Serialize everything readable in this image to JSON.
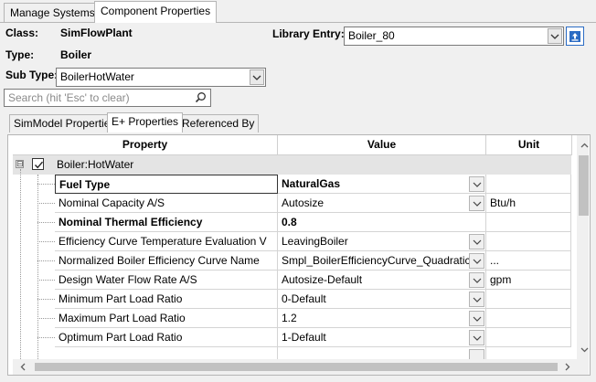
{
  "tabs": [
    {
      "label": "Manage Systems",
      "active": false
    },
    {
      "label": "Component Properties",
      "active": true
    }
  ],
  "header": {
    "class_label": "Class:",
    "class_value": "SimFlowPlant",
    "type_label": "Type:",
    "type_value": "Boiler",
    "subtype_label": "Sub Type:",
    "subtype_value": "BoilerHotWater",
    "library_label": "Library Entry:",
    "library_value": "Boiler_80"
  },
  "search": {
    "placeholder": "Search (hit 'Esc' to clear)"
  },
  "inner_tabs": [
    {
      "label": "SimModel Properties",
      "active": false
    },
    {
      "label": "E+ Properties",
      "active": true
    },
    {
      "label": "Referenced By",
      "active": false
    }
  ],
  "grid": {
    "columns": [
      "Property",
      "Value",
      "Unit"
    ],
    "group": {
      "label": "Boiler:HotWater",
      "checked": true,
      "expander": "⊟"
    },
    "rows": [
      {
        "property": "Fuel Type",
        "value": "NaturalGas",
        "unit": "",
        "bold": true,
        "selected": true
      },
      {
        "property": "Nominal Capacity A/S",
        "value": "Autosize",
        "unit": "Btu/h",
        "bold": false
      },
      {
        "property": "Nominal Thermal Efficiency",
        "value": "0.8",
        "unit": "",
        "bold": true
      },
      {
        "property": "Efficiency Curve Temperature Evaluation V",
        "value": "LeavingBoiler",
        "unit": "",
        "bold": false
      },
      {
        "property": "Normalized Boiler Efficiency Curve Name",
        "value": "Smpl_BoilerEfficiencyCurve_Quadratic",
        "unit": "...",
        "bold": false
      },
      {
        "property": "Design Water Flow Rate A/S",
        "value": "Autosize-Default",
        "unit": "gpm",
        "bold": false
      },
      {
        "property": "Minimum Part Load Ratio",
        "value": "0-Default",
        "unit": "",
        "bold": false
      },
      {
        "property": "Maximum Part Load Ratio",
        "value": "1.2",
        "unit": "",
        "bold": false
      },
      {
        "property": "Optimum Part Load Ratio",
        "value": "1-Default",
        "unit": "",
        "bold": false
      }
    ]
  },
  "icons": {
    "combo": "chevron-down-icon",
    "export": "upload-icon",
    "search": "magnifier-icon",
    "check": "checkmark-icon"
  },
  "colors": {
    "group_row_bg": "#e4e4e4",
    "accent_blue": "#2b6cc4"
  }
}
